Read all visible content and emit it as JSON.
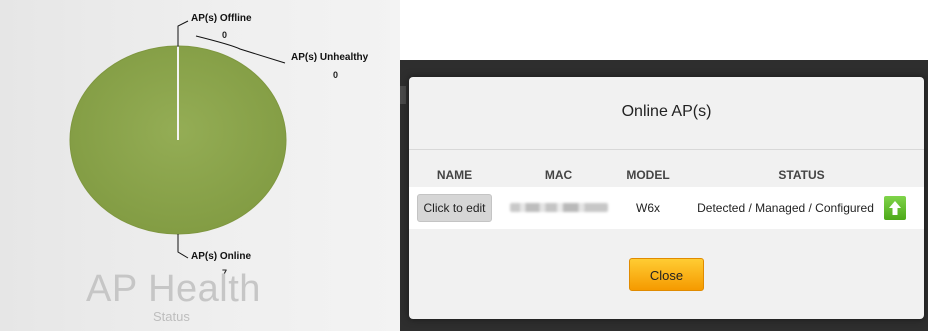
{
  "chart": {
    "title": "AP Health",
    "subtitle": "Status",
    "labels": {
      "offline": "AP(s) Offline",
      "unhealthy": "AP(s) Unhealthy",
      "online": "AP(s) Online"
    },
    "values": {
      "offline": "0",
      "unhealthy": "0",
      "online": "7"
    },
    "colors": {
      "online": "#8aa44b"
    }
  },
  "chart_data": {
    "type": "pie",
    "title": "AP Health",
    "subtitle": "Status",
    "categories": [
      "AP(s) Offline",
      "AP(s) Unhealthy",
      "AP(s) Online"
    ],
    "values": [
      0,
      0,
      7
    ]
  },
  "modal": {
    "title": "Online AP(s)",
    "columns": [
      "NAME",
      "MAC",
      "MODEL",
      "STATUS"
    ],
    "rows": [
      {
        "name_button": "Click to edit",
        "model": "W6x",
        "status": "Detected / Managed / Configured",
        "status_icon": "arrow-up-icon"
      }
    ],
    "close_label": "Close"
  }
}
